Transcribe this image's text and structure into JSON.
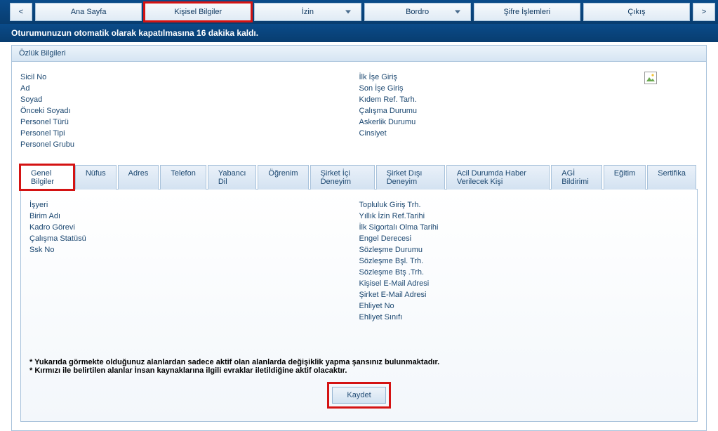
{
  "topnav": {
    "prev": "<",
    "next": ">",
    "items": [
      {
        "label": "Ana Sayfa",
        "dropdown": false,
        "highlighted": false
      },
      {
        "label": "Kişisel Bilgiler",
        "dropdown": false,
        "highlighted": true
      },
      {
        "label": "İzin",
        "dropdown": true,
        "highlighted": false
      },
      {
        "label": "Bordro",
        "dropdown": true,
        "highlighted": false
      },
      {
        "label": "Şifre İşlemleri",
        "dropdown": false,
        "highlighted": false
      },
      {
        "label": "Çıkış",
        "dropdown": false,
        "highlighted": false
      }
    ]
  },
  "session_message": "Oturumunuzun otomatik olarak kapatılmasına 16 dakika kaldı.",
  "panel_title": "Özlük Bilgileri",
  "info_left": [
    "Sicil No",
    "Ad",
    "Soyad",
    "Önceki Soyadı",
    "Personel Türü",
    "Personel Tipi",
    "Personel Grubu"
  ],
  "info_right": [
    "İlk İşe Giriş",
    "Son İşe Giriş",
    "Kıdem Ref. Tarh.",
    "Çalışma Durumu",
    "Askerlik Durumu",
    "Cinsiyet"
  ],
  "tabs": [
    {
      "label": "Genel Bilgiler",
      "active": true
    },
    {
      "label": "Nüfus",
      "active": false
    },
    {
      "label": "Adres",
      "active": false
    },
    {
      "label": "Telefon",
      "active": false
    },
    {
      "label": "Yabancı Dil",
      "active": false
    },
    {
      "label": "Öğrenim",
      "active": false
    },
    {
      "label": "Şirket İçi Deneyim",
      "active": false
    },
    {
      "label": "Şirket Dışı Deneyim",
      "active": false
    },
    {
      "label": "Acil Durumda Haber Verilecek Kişi",
      "active": false
    },
    {
      "label": "AGİ Bildirimi",
      "active": false
    },
    {
      "label": "Eğitim",
      "active": false
    },
    {
      "label": "Sertifika",
      "active": false
    }
  ],
  "tab_left": [
    "İşyeri",
    "Birim Adı",
    "Kadro Görevi",
    "Çalışma Statüsü",
    "Ssk No"
  ],
  "tab_right": [
    "Topluluk Giriş Trh.",
    "Yıllık İzin Ref.Tarihi",
    "İlk Sigortalı Olma Tarihi",
    "Engel Derecesi",
    "Sözleşme Durumu",
    "Sözleşme Bşl. Trh.",
    "Sözleşme Btş .Trh.",
    "Kişisel E-Mail Adresi",
    "Şirket E-Mail Adresi",
    "Ehliyet No",
    "Ehliyet Sınıfı"
  ],
  "note1": "* Yukarıda görmekte olduğunuz alanlardan sadece aktif olan alanlarda değişiklik yapma şansınız bulunmaktadır.",
  "note2": "* Kırmızı ile belirtilen alanlar İnsan kaynaklarına ilgili evraklar iletildiğine aktif olacaktır.",
  "save_label": "Kaydet"
}
